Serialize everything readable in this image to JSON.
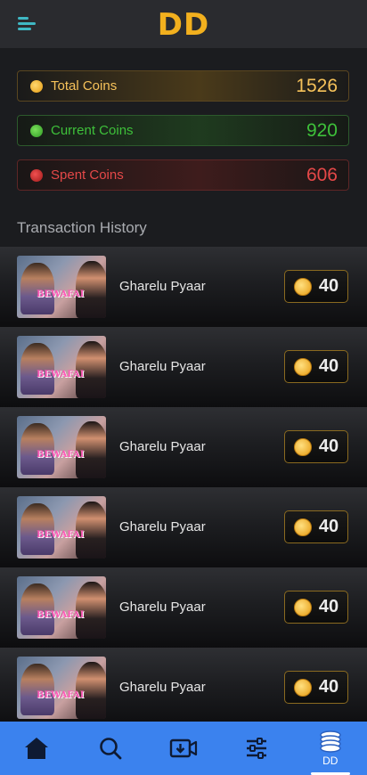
{
  "header": {
    "logo": "DD",
    "menu_icon": "hamburger-menu-icon"
  },
  "stats": {
    "total": {
      "label": "Total Coins",
      "value": "1526",
      "color": "#f6c25a"
    },
    "current": {
      "label": "Current Coins",
      "value": "920",
      "color": "#3ec03a"
    },
    "spent": {
      "label": "Spent Coins",
      "value": "606",
      "color": "#e54848"
    }
  },
  "history": {
    "title": "Transaction History",
    "items": [
      {
        "name": "Gharelu Pyaar",
        "coins": "40",
        "thumb_text": "BEWAFAI"
      },
      {
        "name": "Gharelu Pyaar",
        "coins": "40",
        "thumb_text": "BEWAFAI"
      },
      {
        "name": "Gharelu Pyaar",
        "coins": "40",
        "thumb_text": "BEWAFAI"
      },
      {
        "name": "Gharelu Pyaar",
        "coins": "40",
        "thumb_text": "BEWAFAI"
      },
      {
        "name": "Gharelu Pyaar",
        "coins": "40",
        "thumb_text": "BEWAFAI"
      },
      {
        "name": "Gharelu Pyaar",
        "coins": "40",
        "thumb_text": "BEWAFAI"
      }
    ]
  },
  "nav": {
    "items": [
      {
        "icon": "home-icon"
      },
      {
        "icon": "search-icon"
      },
      {
        "icon": "download-icon"
      },
      {
        "icon": "sliders-icon"
      },
      {
        "icon": "coins-icon",
        "label": "DD",
        "active": true
      }
    ],
    "bg_color": "#3b82ee"
  }
}
